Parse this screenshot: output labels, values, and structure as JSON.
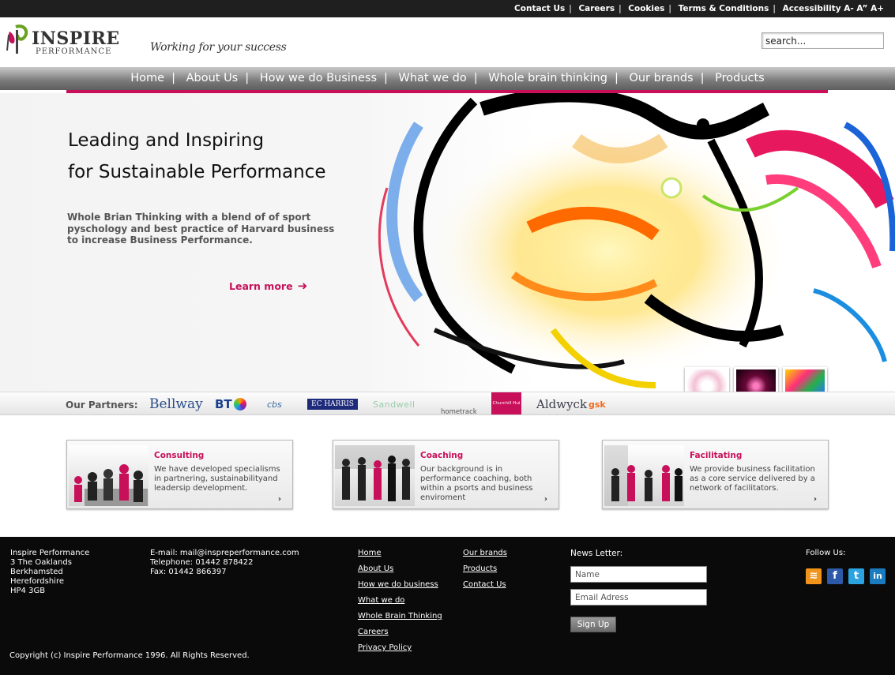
{
  "top_links": [
    "Contact Us",
    "Careers",
    "Cookies",
    "Terms & Conditions",
    "Accessibility A- A” A+"
  ],
  "logo": {
    "name": "INSPIRE",
    "sub": "PERFORMANCE"
  },
  "tagline": "Working for your success",
  "search": {
    "placeholder": "search..."
  },
  "nav": [
    "Home",
    "About Us",
    "How we do Business",
    "What we do",
    "Whole brain thinking",
    "Our brands",
    "Products"
  ],
  "hero": {
    "title_line1": "Leading and Inspiring",
    "title_line2": "for Sustainable Performance",
    "body": "Whole Brian Thinking with a blend of of sport pyschology and best practice of Harvard business to increase Business Performance.",
    "cta": "Learn more",
    "cta_icon": "arrow-right-icon"
  },
  "partners": {
    "label": "Our Partners:",
    "logos": [
      "Bellway",
      "BT",
      "cbs",
      "EC HARRIS",
      "Sandwell",
      "hometrack",
      "Churchill Hui",
      "Aldwyck",
      "gsk"
    ]
  },
  "services": [
    {
      "title": "Consulting",
      "text": "We have developed specialisms in partnering, sustainabilityand leadersip development."
    },
    {
      "title": "Coaching",
      "text": "Our background is in performance coaching, both within a psorts and business enviroment"
    },
    {
      "title": "Facilitating",
      "text": "We provide business facilitation as a core service delivered by a network of facilitators."
    }
  ],
  "footer": {
    "address": [
      "Inspire Performance",
      "3 The Oaklands",
      "Berkhamsted",
      "Herefordshire",
      "HP4 3GB"
    ],
    "email": "E-mail: mail@inspreperformance.com",
    "telephone": "Telephone: 01442 878422",
    "fax": "Fax: 01442 866397",
    "links_col1": [
      "Home",
      "About Us",
      "How we do business",
      "What we do",
      "Whole Brain Thinking",
      "Careers",
      "Privacy Policy"
    ],
    "links_col2": [
      "Our brands",
      "Products",
      "Contact Us"
    ],
    "newsletter_label": "News Letter:",
    "name_placeholder": "Name",
    "email_placeholder": "Email Adress",
    "signup_label": "Sign Up",
    "follow_label": "Follow Us:",
    "copyright": "Copyright (c) Inspire Performance 1996. All Rights Reserved."
  },
  "colors": {
    "accent": "#c8105a",
    "footer_bg": "#0a0a0a",
    "topbar_bg": "#1f1f1f"
  }
}
